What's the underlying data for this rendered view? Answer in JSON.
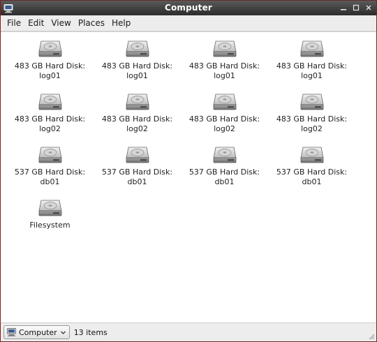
{
  "window": {
    "title": "Computer"
  },
  "menubar": {
    "items": [
      "File",
      "Edit",
      "View",
      "Places",
      "Help"
    ]
  },
  "devices": [
    {
      "label": "483 GB Hard Disk:\nlog01",
      "icon": "hard-disk-icon"
    },
    {
      "label": "483 GB Hard Disk:\nlog01",
      "icon": "hard-disk-icon"
    },
    {
      "label": "483 GB Hard Disk:\nlog01",
      "icon": "hard-disk-icon"
    },
    {
      "label": "483 GB Hard Disk:\nlog01",
      "icon": "hard-disk-icon"
    },
    {
      "label": "483 GB Hard Disk:\nlog02",
      "icon": "hard-disk-icon"
    },
    {
      "label": "483 GB Hard Disk:\nlog02",
      "icon": "hard-disk-icon"
    },
    {
      "label": "483 GB Hard Disk:\nlog02",
      "icon": "hard-disk-icon"
    },
    {
      "label": "483 GB Hard Disk:\nlog02",
      "icon": "hard-disk-icon"
    },
    {
      "label": "537 GB Hard Disk:\ndb01",
      "icon": "hard-disk-icon"
    },
    {
      "label": "537 GB Hard Disk:\ndb01",
      "icon": "hard-disk-icon"
    },
    {
      "label": "537 GB Hard Disk:\ndb01",
      "icon": "hard-disk-icon"
    },
    {
      "label": "537 GB Hard Disk:\ndb01",
      "icon": "hard-disk-icon"
    },
    {
      "label": "Filesystem",
      "icon": "hard-disk-icon"
    }
  ],
  "statusbar": {
    "location_label": "Computer",
    "items_count": "13 items"
  },
  "colors": {
    "titlebar": "#2c2c2c",
    "window_border": "#6b2a2a",
    "content_bg": "#ffffff"
  }
}
